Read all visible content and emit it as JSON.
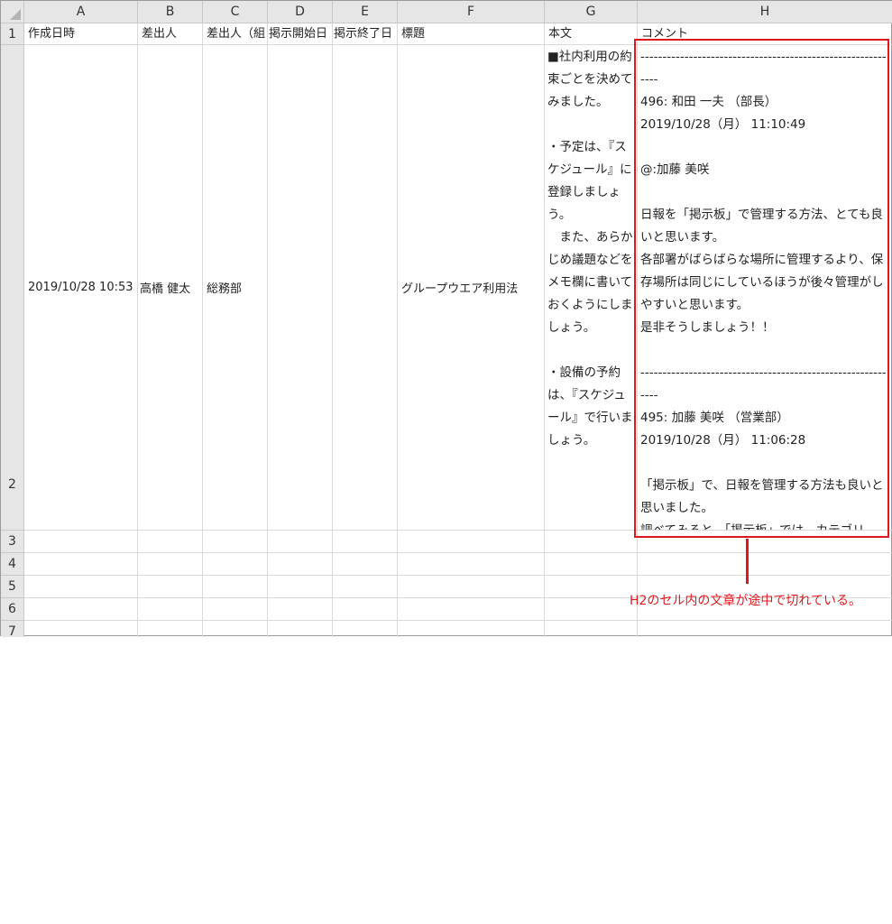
{
  "columns": [
    "A",
    "B",
    "C",
    "D",
    "E",
    "F",
    "G",
    "H"
  ],
  "rows": [
    "1",
    "2",
    "3",
    "4",
    "5",
    "6",
    "7"
  ],
  "header_row": [
    "作成日時",
    "差出人",
    "差出人（組",
    "掲示開始日",
    "掲示終了日",
    "標題",
    "本文",
    "コメント"
  ],
  "data_row": {
    "created": "2019/10/28 10:53",
    "sender": "高橋 健太",
    "sender_dept": "総務部",
    "start": "",
    "end": "",
    "subject": "グループウエア利用法",
    "body": "■社内利用の約束ごとを決めてみました。\n\n・予定は、『スケジュール』に登録しましょう。\n　また、あらかじめ議題などをメモ欄に書いておくようにしましょう。\n\n・設備の予約は、『スケジュール』で行いましょう。",
    "comment": "------------------------------------------------------------\n496: 和田 一夫 （部長）\n2019/10/28（月） 11:10:49\n\n@:加藤 美咲\n\n日報を「掲示板」で管理する方法、とても良いと思います。\n各部署がばらばらな場所に管理するより、保存場所は同じにしているほうが後々管理がしやすいと思います。\n是非そうしましょう！！\n\n------------------------------------------------------------\n495: 加藤 美咲 （営業部）\n2019/10/28（月） 11:06:28\n\n「掲示板」で、日報を管理する方法も良いと思いました。\n調べてみると、「掲示板」では、カテゴリ"
  },
  "annotation": {
    "text": "H2のセル内の文章が途中で切れている。",
    "color": "#e0181e"
  }
}
